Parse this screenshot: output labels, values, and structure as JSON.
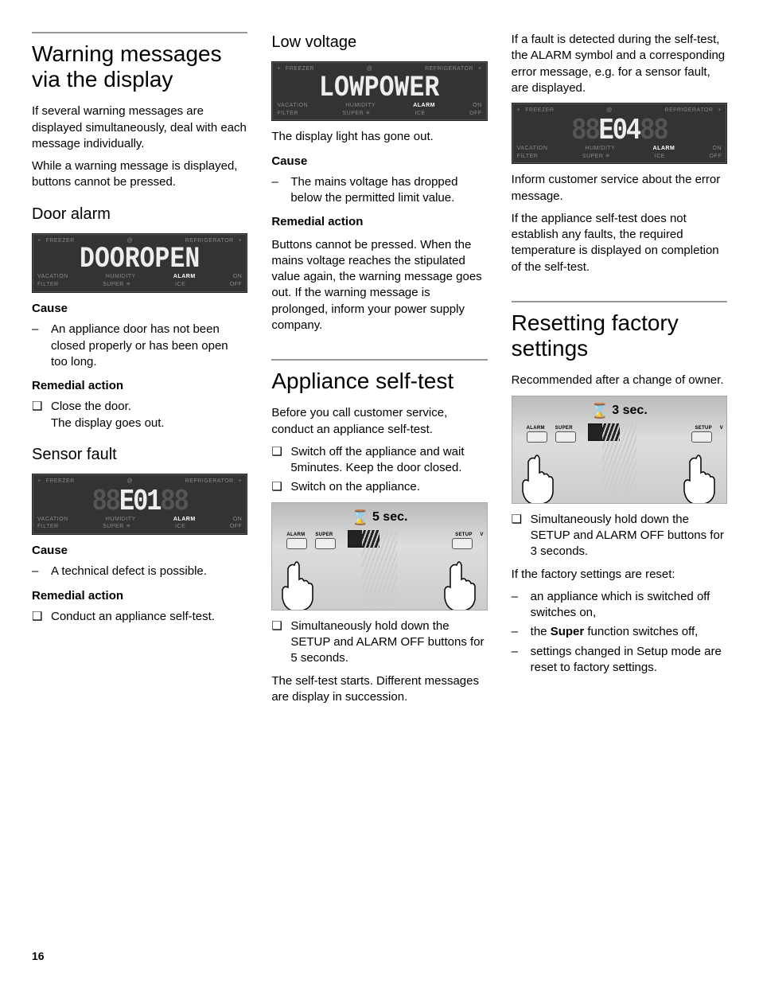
{
  "page_number": "16",
  "panel_labels": {
    "top_left_icon": "+",
    "top_freezer": "FREEZER",
    "top_at": "@",
    "top_refrigerator": "REFRIGERATOR",
    "top_right_icon": "+",
    "row1_vacation": "VACATION",
    "row1_humidity": "HUMIDITY",
    "row1_alarm": "ALARM",
    "row1_on": "ON",
    "row2_filter": "FILTER",
    "row2_super": "SUPER ✳",
    "row2_ice": "ICE",
    "row2_off": "OFF"
  },
  "col1": {
    "h1": "Warning messages via the display",
    "p1": "If several warning messages are displayed simultaneously, deal with each message individually.",
    "p2": "While a warning message is displayed, buttons cannot be pressed.",
    "door": {
      "h2": "Door alarm",
      "display_text": "DOOROPEN",
      "cause_h": "Cause",
      "cause_items": [
        "An appliance door has not been closed properly or has been open too long."
      ],
      "rem_h": "Remedial action",
      "rem_items": [
        "Close the door.\nThe display goes out."
      ]
    },
    "sensor": {
      "h2": "Sensor fault",
      "display_text": "E01",
      "cause_h": "Cause",
      "cause_items": [
        "A technical defect is possible."
      ],
      "rem_h": "Remedial action",
      "rem_items": [
        "Conduct an appliance self-test."
      ]
    }
  },
  "col2": {
    "low": {
      "h2": "Low voltage",
      "display_text": "LOWPOWER",
      "p1": "The display light has gone out.",
      "cause_h": "Cause",
      "cause_items": [
        "The mains voltage has dropped below the permitted limit value."
      ],
      "rem_h": "Remedial action",
      "rem_p": "Buttons cannot be pressed. When the mains voltage reaches the stipulated value again, the warning message goes out. If the warning message is prolonged, inform your power supply company."
    },
    "selftest": {
      "h1": "Appliance self-test",
      "p1": "Before you call customer service, conduct an appliance self-test.",
      "steps1": [
        "Switch off the appliance and wait 5minutes. Keep the door closed.",
        "Switch on the appliance."
      ],
      "fig_time": "5 sec.",
      "btn_alarm": "ALARM",
      "btn_super": "SUPER",
      "btn_setup": "SETUP",
      "btn_v": "V",
      "steps2": [
        "Simultaneously hold down the SETUP and ALARM OFF buttons for 5 seconds."
      ],
      "p2": "The self-test starts. Different messages are display in succession."
    }
  },
  "col3": {
    "p1": "If a fault is detected during the self-test, the ALARM symbol and a corresponding error message, e.g. for a sensor fault, are displayed.",
    "display_text": "E04",
    "p2": "Inform customer service about the error message.",
    "p3": "If the appliance self-test does not establish any faults, the required temperature is displayed on completion of the self-test.",
    "reset": {
      "h1": "Resetting factory settings",
      "p1": "Recommended after a change of owner.",
      "fig_time": "3 sec.",
      "btn_alarm": "ALARM",
      "btn_super": "SUPER",
      "btn_setup": "SETUP",
      "btn_v": "V",
      "steps": [
        "Simultaneously hold down the SETUP and ALARM OFF buttons for 3 seconds."
      ],
      "p2": "If the factory settings are reset:",
      "results": [
        "an appliance which is switched off switches on,",
        "the <b>Super</b> function switches off,",
        "settings changed in Setup mode are reset to factory settings."
      ]
    }
  }
}
